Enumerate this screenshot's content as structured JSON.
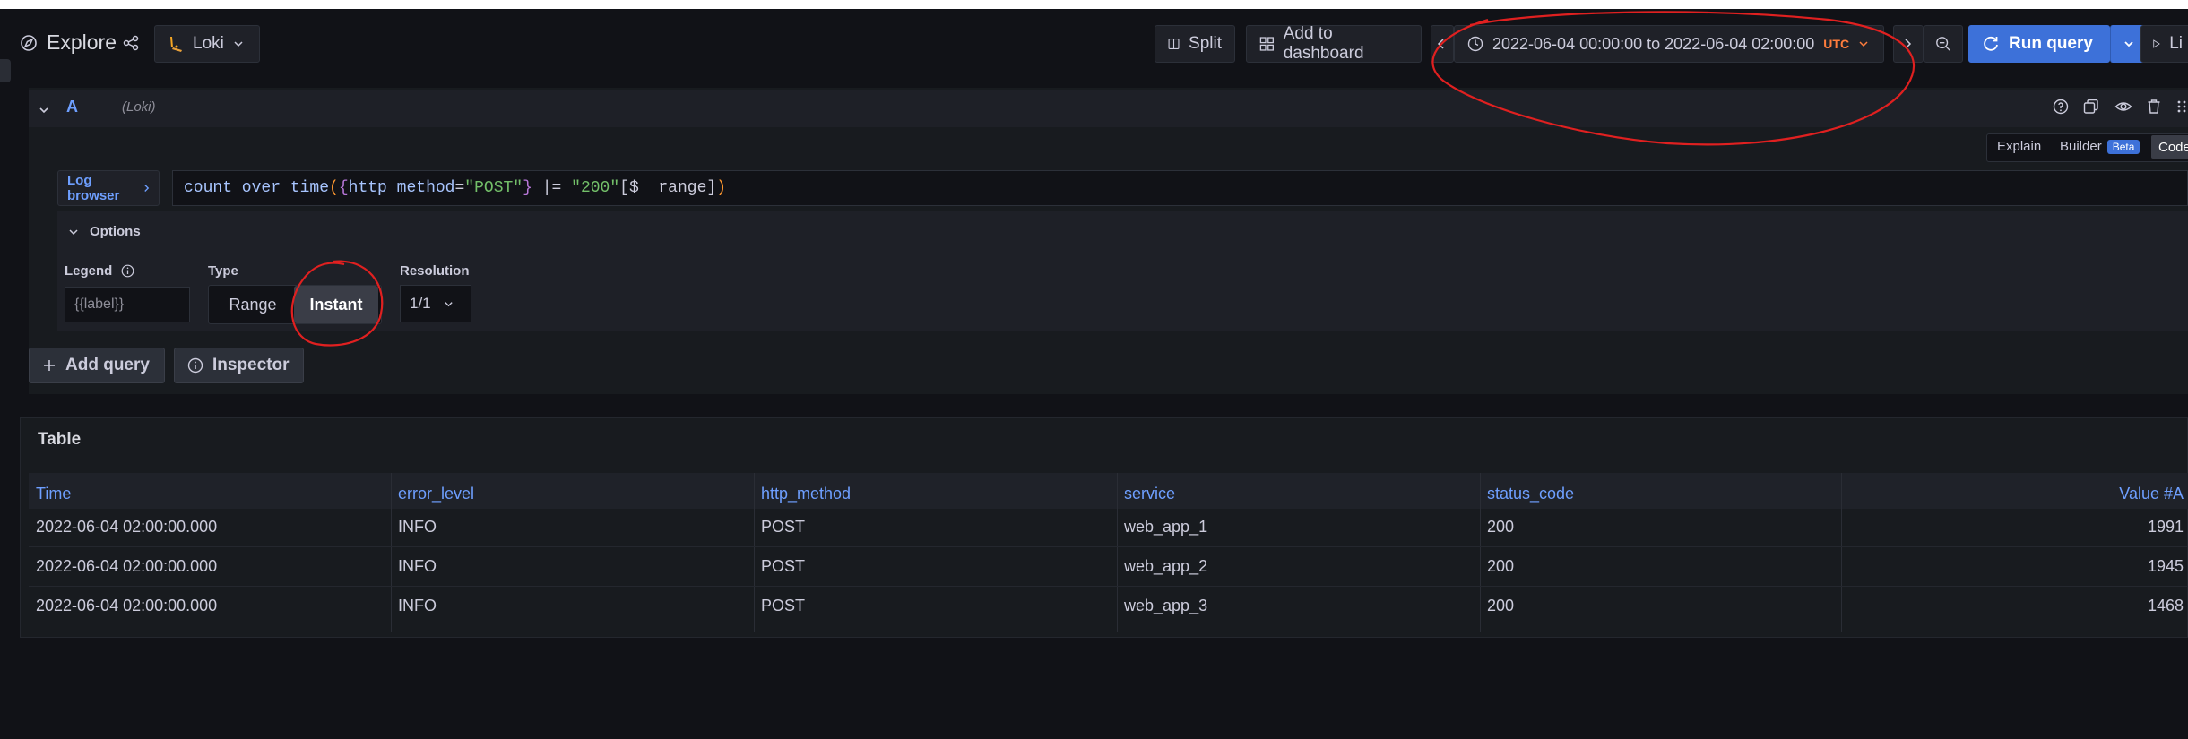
{
  "header": {
    "title": "Explore",
    "datasource": "Loki",
    "split_label": "Split",
    "add_dashboard_label": "Add to dashboard",
    "time_range": "2022-06-04 00:00:00 to 2022-06-04 02:00:00",
    "timezone": "UTC",
    "run_query_label": "Run query",
    "live_label": "Li"
  },
  "query": {
    "ref": "A",
    "datasource_hint": "(Loki)",
    "mode_tabs": {
      "explain": "Explain",
      "builder": "Builder",
      "beta": "Beta",
      "code": "Code"
    },
    "log_browser_label": "Log browser",
    "expr_parts": {
      "fn": "count_over_time",
      "paren_open": "(",
      "brace_open": "{",
      "label": "http_method",
      "eq": "=",
      "label_value": "\"POST\"",
      "brace_close": "}",
      "op": " |= ",
      "line_value": "\"200\"",
      "range": "[$__range]",
      "paren_close": ")"
    },
    "options_label": "Options",
    "legend_label": "Legend",
    "legend_placeholder": "{{label}}",
    "type_label": "Type",
    "type_range": "Range",
    "type_instant": "Instant",
    "resolution_label": "Resolution",
    "resolution_value": "1/1",
    "add_query_label": "Add query",
    "inspector_label": "Inspector"
  },
  "table": {
    "title": "Table",
    "columns": [
      "Time",
      "error_level",
      "http_method",
      "service",
      "status_code",
      "Value #A"
    ],
    "rows": [
      [
        "2022-06-04 02:00:00.000",
        "INFO",
        "POST",
        "web_app_1",
        "200",
        "1991"
      ],
      [
        "2022-06-04 02:00:00.000",
        "INFO",
        "POST",
        "web_app_2",
        "200",
        "1945"
      ],
      [
        "2022-06-04 02:00:00.000",
        "INFO",
        "POST",
        "web_app_3",
        "200",
        "1468"
      ]
    ]
  },
  "colors": {
    "accent": "#3d71d9",
    "annotation": "#e02020",
    "link": "#6e9fff",
    "timezone": "#ff7d3d"
  }
}
